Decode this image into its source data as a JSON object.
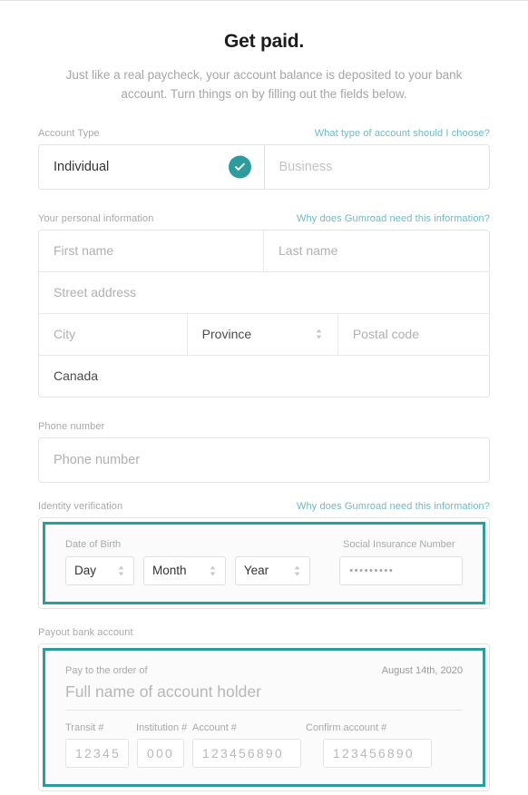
{
  "header": {
    "title": "Get paid.",
    "subtitle": "Just like a real paycheck, your account balance is deposited to your bank account. Turn things on by filling out the fields below."
  },
  "account_type": {
    "label": "Account Type",
    "help_link": "What type of account should I choose?",
    "options": [
      {
        "label": "Individual",
        "selected": true
      },
      {
        "label": "Business",
        "selected": false
      }
    ],
    "selected_icon": "check-icon"
  },
  "personal_information": {
    "label": "Your personal information",
    "help_link": "Why does Gumroad need this information?",
    "first_name_placeholder": "First name",
    "last_name_placeholder": "Last name",
    "street_placeholder": "Street address",
    "city_placeholder": "City",
    "province_value": "Province",
    "postal_code_placeholder": "Postal code",
    "country_value": "Canada"
  },
  "phone": {
    "label": "Phone number",
    "placeholder": "Phone number"
  },
  "identity_verification": {
    "label": "Identity verification",
    "help_link": "Why does Gumroad need this information?",
    "dob_label": "Date of Birth",
    "sin_label": "Social Insurance Number",
    "day_value": "Day",
    "month_value": "Month",
    "year_value": "Year",
    "sin_masked": "•••••••••"
  },
  "payout_bank_account": {
    "label": "Payout bank account",
    "pay_to_label": "Pay to the order of",
    "date": "August 14th, 2020",
    "payee_placeholder": "Full name of account holder",
    "transit_label": "Transit #",
    "institution_label": "Institution #",
    "account_label": "Account #",
    "confirm_label": "Confirm account #",
    "transit_placeholder": "12345",
    "institution_placeholder": "000",
    "account_placeholder": "123456890",
    "confirm_placeholder": "123456890"
  },
  "colors": {
    "accent": "#2e9c9c",
    "link": "#6fb9c4",
    "label": "#a9a9a9",
    "placeholder": "#b0b0b0"
  }
}
